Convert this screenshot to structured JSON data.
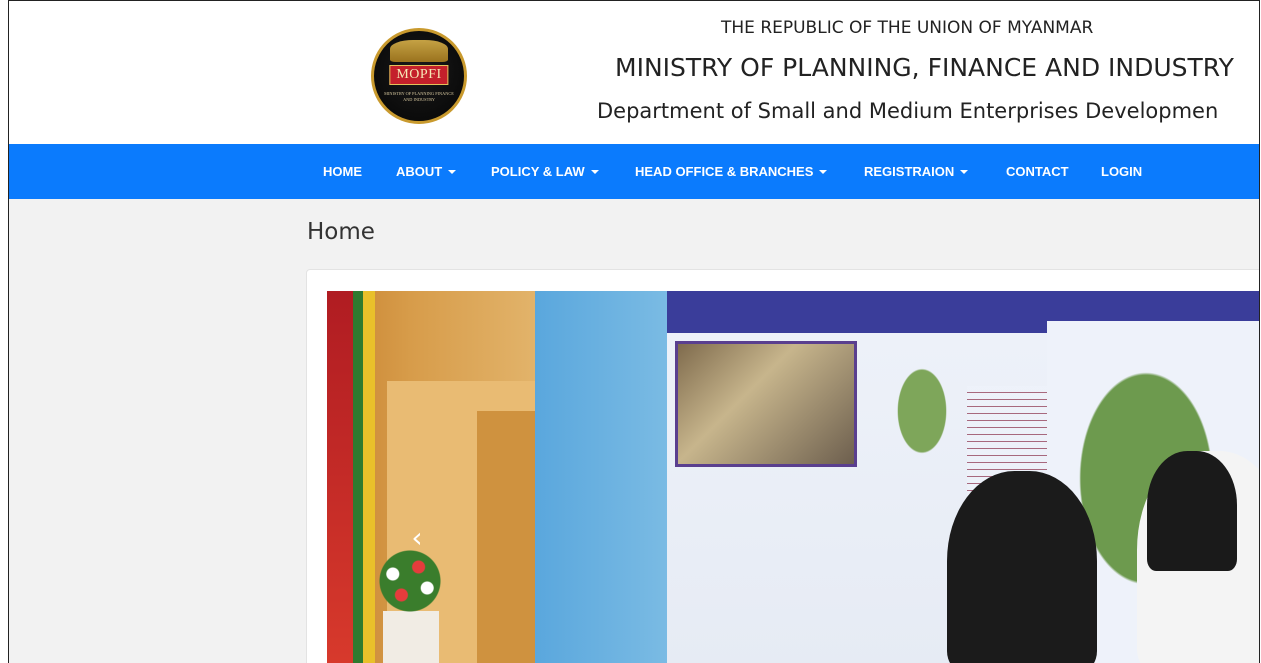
{
  "header": {
    "logo": {
      "emblem_text": "MOPFI",
      "caption": "MINISTRY OF PLANNING FINANCE AND INDUSTRY"
    },
    "line1": "THE REPUBLIC OF THE UNION OF MYANMAR",
    "line2": "MINISTRY OF PLANNING, FINANCE AND INDUSTRY",
    "line3": "Department of Small and Medium Enterprises Developmen"
  },
  "nav": {
    "background_color": "#0b7bfd",
    "items": [
      {
        "label": "HOME",
        "dropdown": false
      },
      {
        "label": "ABOUT",
        "dropdown": true
      },
      {
        "label": "POLICY & LAW",
        "dropdown": true
      },
      {
        "label": "HEAD OFFICE & BRANCHES",
        "dropdown": true
      },
      {
        "label": "REGISTRAION",
        "dropdown": true
      },
      {
        "label": "CONTACT",
        "dropdown": false
      },
      {
        "label": "LOGIN",
        "dropdown": false
      }
    ]
  },
  "main": {
    "page_title": "Home",
    "carousel": {
      "prev_icon": "‹"
    }
  }
}
